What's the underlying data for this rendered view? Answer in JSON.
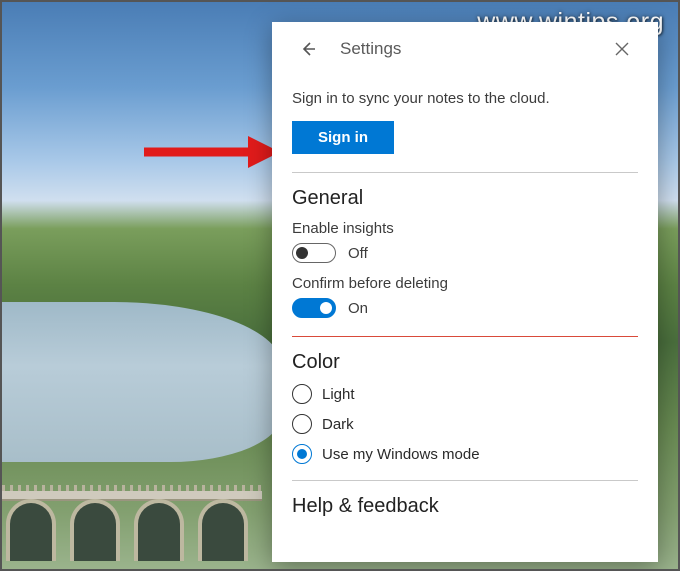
{
  "watermark": "www.wintips.org",
  "panel": {
    "title": "Settings",
    "sync_prompt": "Sign in to sync your notes to the cloud.",
    "signin_label": "Sign in",
    "sections": {
      "general": {
        "heading": "General",
        "insights": {
          "label": "Enable insights",
          "state_label": "Off",
          "on": false
        },
        "confirm_delete": {
          "label": "Confirm before deleting",
          "state_label": "On",
          "on": true
        }
      },
      "color": {
        "heading": "Color",
        "options": [
          {
            "label": "Light",
            "selected": false
          },
          {
            "label": "Dark",
            "selected": false
          },
          {
            "label": "Use my Windows mode",
            "selected": true
          }
        ]
      },
      "help": {
        "heading": "Help & feedback"
      }
    }
  },
  "colors": {
    "accent": "#0078d4",
    "arrow": "#e11b1b"
  }
}
